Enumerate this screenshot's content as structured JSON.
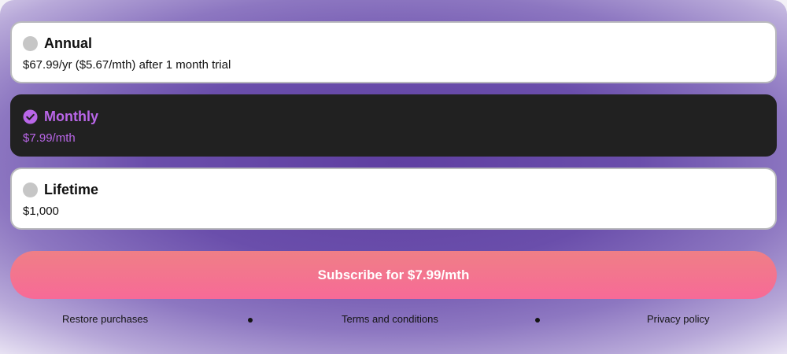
{
  "plans": [
    {
      "title": "Annual",
      "price": "$67.99/yr ($5.67/mth) after 1 month trial",
      "selected": false,
      "icon": "radio-unselected-icon"
    },
    {
      "title": "Monthly",
      "price": "$7.99/mth",
      "selected": true,
      "icon": "check-circle-icon"
    },
    {
      "title": "Lifetime",
      "price": "$1,000",
      "selected": false,
      "icon": "radio-unselected-icon"
    }
  ],
  "subscribe_label": "Subscribe for $7.99/mth",
  "footer": {
    "restore": "Restore purchases",
    "terms": "Terms and conditions",
    "privacy": "Privacy policy"
  },
  "colors": {
    "accent": "#b966e8",
    "selected_card": "#212121",
    "button_top": "#ef7f86",
    "button_bottom": "#f76a97",
    "background": "#6a4eab"
  }
}
